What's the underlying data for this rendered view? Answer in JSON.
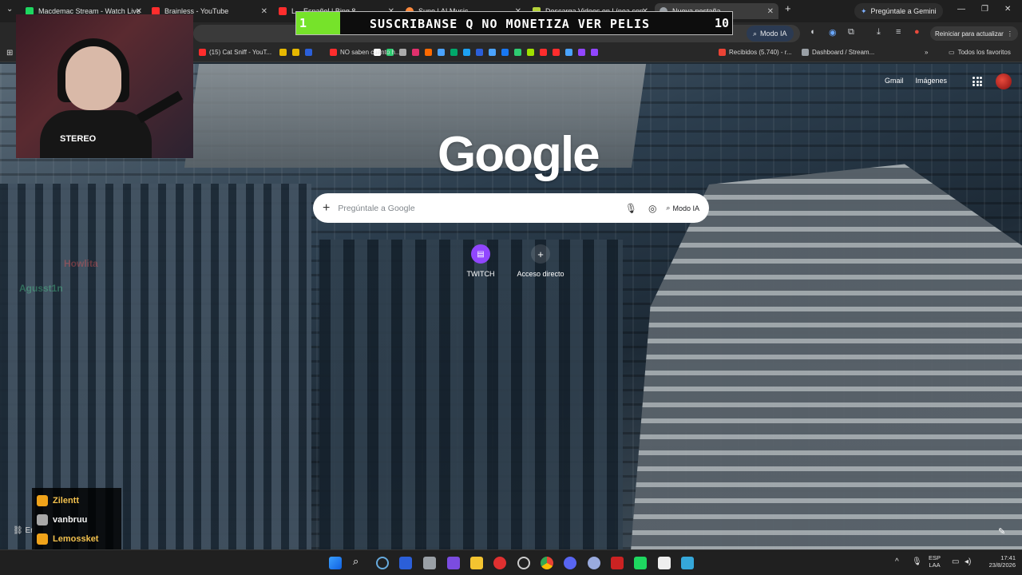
{
  "tabs": [
    {
      "label": "Macdemac Stream - Watch Live",
      "color": "#1ed760"
    },
    {
      "label": "Brainless - YouTube",
      "color": "#ff2d2d"
    },
    {
      "label": "L... Español | Bing 8...",
      "color": "#ff2d2d"
    },
    {
      "label": "Suno | AI Music",
      "color": "#ff8a3d"
    },
    {
      "label": "Descarga Videos en Línea con...",
      "color": "#b5d33a"
    },
    {
      "label": "Nueva pestaña",
      "color": "#9aa0a6"
    }
  ],
  "new_tab_symbol": "+",
  "gemini_button": "Pregúntale a Gemini",
  "toolbar": {
    "modo_ia": "Modo IA",
    "update_button": "Reiniciar para actualizar"
  },
  "bookmarks": [
    {
      "label": "(15) Cat Sniff - YouT...",
      "color": "#ff2d2d"
    },
    {
      "label": "NO saben cuánto h...",
      "color": "#ff2d2d"
    },
    {
      "label": "Recibidos (5.740) - r...",
      "color": "#ea4335"
    },
    {
      "label": "Dashboard / Stream...",
      "color": "#9aa0a6"
    }
  ],
  "bookmark_icons": [
    "#e6b800",
    "#e6b800",
    "#2b5fd9",
    "#ffffff",
    "#2ecc71",
    "#aaa",
    "#e1306c",
    "#ff6a00",
    "#4aa3ff",
    "#00a86b",
    "#1da1f2",
    "#2b5fd9",
    "#4aa3ff",
    "#1877f2",
    "#2ecc71",
    "#a0e000",
    "#ff2d2d",
    "#ff2d2d",
    "#4aa3ff",
    "#9146ff",
    "#9146ff"
  ],
  "all_bookmarks": "Todos los favoritos",
  "google": {
    "logo": "Google",
    "gmail": "Gmail",
    "images": "Imágenes",
    "search_placeholder": "Pregúntale a Google",
    "modo_ia": "Modo IA",
    "shortcuts": [
      {
        "label": "TWITCH",
        "icon": "twitch-icon"
      },
      {
        "label": "Acceso directo",
        "icon": "plus-icon"
      }
    ]
  },
  "stream_overlay": {
    "sub_goal_current": "1",
    "sub_goal_target": "10",
    "sub_goal_progress": 0.1,
    "message": "SUSCRIBANSE Q NO MONETIZA VER PELIS",
    "webcam_shirt_text": "STEREO",
    "ghost_chat": [
      "Howlita",
      "Agusst1n"
    ],
    "viewers": [
      {
        "name": "Zilentt",
        "badge": "gold"
      },
      {
        "name": "vanbruu",
        "badge": "grey"
      },
      {
        "name": "Lemossket",
        "badge": "gold"
      }
    ],
    "link_text": "Er"
  },
  "taskbar": {
    "language": "ESP",
    "layout": "LAA",
    "time": "17:41",
    "date": "23/8/2026"
  }
}
